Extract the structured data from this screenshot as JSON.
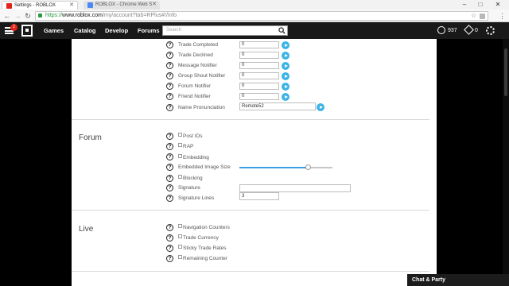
{
  "browser": {
    "tabs": [
      {
        "title": "Settings - ROBLOX",
        "active": true
      },
      {
        "title": "ROBLOX - Chrome Web S",
        "active": false
      }
    ],
    "url_scheme": "https://",
    "url_host": "www.roblox.com",
    "url_path": "/my/account?tab=RPlus#!/info",
    "window_controls": [
      "–",
      "□",
      "✕"
    ],
    "nav_icons": [
      "back-arrow-icon",
      "forward-arrow-icon",
      "reload-icon"
    ]
  },
  "nav": {
    "notification_count": "2",
    "links": [
      "Games",
      "Catalog",
      "Develop",
      "Forums"
    ],
    "search_placeholder": "Search",
    "robux": "937",
    "trade_count": "0"
  },
  "trade_rows": [
    {
      "label": "Trade Completed",
      "value": "0"
    },
    {
      "label": "Trade Declined",
      "value": "0"
    },
    {
      "label": "Message Notifier",
      "value": "0"
    },
    {
      "label": "Group Shout Notifier",
      "value": "0"
    },
    {
      "label": "Forum Notifier",
      "value": "0"
    },
    {
      "label": "Friend Notifier",
      "value": "0"
    }
  ],
  "name_pronunciation": {
    "label": "Name Pronunciation",
    "value": "Remote52"
  },
  "forum": {
    "title": "Forum",
    "post_ids": "Post IDs",
    "rap": "RAP",
    "embedding": "Embedding",
    "embedded_image_size_label": "Embedded Image Size",
    "embedded_image_size_fraction": 0.74,
    "blocking": "Blocking",
    "signature_label": "Signature",
    "signature_value": "",
    "signature_lines_label": "Signature Lines",
    "signature_lines_value": "3"
  },
  "live": {
    "title": "Live",
    "items": [
      "Navigation Counters",
      "Trade Currency",
      "Sticky Trade Rates",
      "Remaining Counter"
    ]
  },
  "chat": {
    "label": "Chat & Party"
  },
  "colors": {
    "accent": "#3bb3e6",
    "navbar": "#191919",
    "badge": "#e2231a"
  }
}
